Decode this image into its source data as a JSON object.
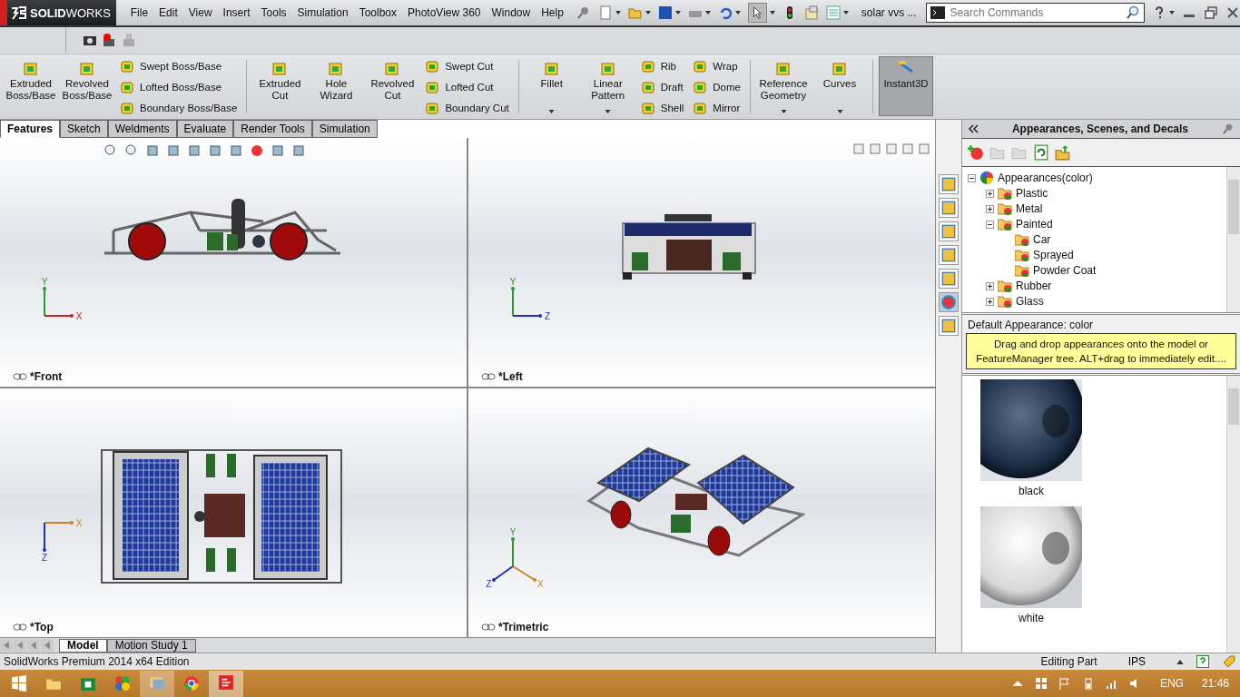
{
  "app": {
    "logo": "**SOLID**WORKS"
  },
  "menu": [
    "File",
    "Edit",
    "View",
    "Insert",
    "Tools",
    "Simulation",
    "Toolbox",
    "PhotoView 360",
    "Window",
    "Help"
  ],
  "document_title": "solar vvs ...",
  "search": {
    "placeholder": "Search Commands"
  },
  "ribbon": [
    {
      "items": [
        {
          "label": "Extruded Boss/Base",
          "kind": "large",
          "dropdown": false
        },
        {
          "label": "Revolved Boss/Base",
          "kind": "large",
          "dropdown": false
        }
      ],
      "stacks": [
        [
          "Swept Boss/Base",
          "Lofted Boss/Base",
          "Boundary Boss/Base"
        ]
      ]
    },
    {
      "items": [
        {
          "label": "Extruded Cut",
          "kind": "large",
          "dropdown": false
        },
        {
          "label": "Hole Wizard",
          "kind": "large",
          "dropdown": false
        },
        {
          "label": "Revolved Cut",
          "kind": "large",
          "dropdown": false
        }
      ],
      "stacks": [
        [
          "Swept Cut",
          "Lofted Cut",
          "Boundary Cut"
        ]
      ]
    },
    {
      "items": [
        {
          "label": "Fillet",
          "kind": "large",
          "dropdown": true
        },
        {
          "label": "Linear Pattern",
          "kind": "large",
          "dropdown": true
        }
      ],
      "stacks": [
        [
          "Rib",
          "Draft",
          "Shell"
        ],
        [
          "Wrap",
          "Dome",
          "Mirror"
        ]
      ]
    },
    {
      "items": [
        {
          "label": "Reference Geometry",
          "kind": "large",
          "dropdown": true
        },
        {
          "label": "Curves",
          "kind": "large",
          "dropdown": true
        }
      ]
    },
    {
      "items": [
        {
          "label": "Instant3D",
          "kind": "toggle",
          "on": true
        }
      ]
    }
  ],
  "command_tabs": [
    {
      "label": "Features",
      "selected": true
    },
    {
      "label": "Sketch",
      "selected": false
    },
    {
      "label": "Weldments",
      "selected": false
    },
    {
      "label": "Evaluate",
      "selected": false
    },
    {
      "label": "Render Tools",
      "selected": false
    },
    {
      "label": "Simulation",
      "selected": false
    }
  ],
  "viewports": [
    {
      "kind": "front",
      "axes": [
        {
          "label": "Y",
          "color": "#2a9a2a"
        },
        {
          "label": "X",
          "color": "#d02020"
        }
      ],
      "label": "*Front"
    },
    {
      "kind": "left",
      "axes": [
        {
          "label": "Y",
          "color": "#2a9a2a"
        },
        {
          "label": "Z",
          "color": "#2030c0"
        }
      ],
      "label": "*Left"
    },
    {
      "kind": "top",
      "axes": [
        {
          "label": "X",
          "color": "#d08020"
        },
        {
          "label": "Z",
          "color": "#2030c0"
        }
      ],
      "label": "*Top"
    },
    {
      "kind": "trimetric",
      "label": "*Trimetric",
      "axes": [
        {
          "label": "Y",
          "color": "#2a9a2a"
        },
        {
          "label": "Z",
          "color": "#2030c0"
        },
        {
          "label": "X",
          "color": "#d08020"
        }
      ]
    }
  ],
  "bottom_tabs": [
    {
      "label": "Model",
      "selected": true
    },
    {
      "label": "Motion Study 1",
      "selected": false
    }
  ],
  "panel": {
    "title": "Appearances, Scenes, and Decals",
    "tree": [
      {
        "label": "Appearances(color)",
        "expanded": true,
        "children": [
          {
            "label": "Plastic",
            "expanded": false
          },
          {
            "label": "Metal",
            "expanded": false
          },
          {
            "label": "Painted",
            "expanded": true,
            "children": [
              {
                "label": "Car"
              },
              {
                "label": "Sprayed"
              },
              {
                "label": "Powder Coat"
              }
            ]
          },
          {
            "label": "Rubber",
            "expanded": false
          },
          {
            "label": "Glass",
            "expanded": false
          }
        ]
      }
    ],
    "default_label": "Default Appearance: color",
    "hint": "Drag and drop appearances onto the model or FeatureManager tree.  ALT+drag to immediately edit....",
    "swatches": [
      {
        "label": "black",
        "kind": "dark"
      },
      {
        "label": "white",
        "kind": "light"
      }
    ]
  },
  "status_bar": {
    "edition": "SolidWorks Premium 2014 x64 Edition",
    "mode": "Editing Part",
    "units": "IPS"
  },
  "taskbar": {
    "language": "ENG",
    "time": "21:46"
  }
}
